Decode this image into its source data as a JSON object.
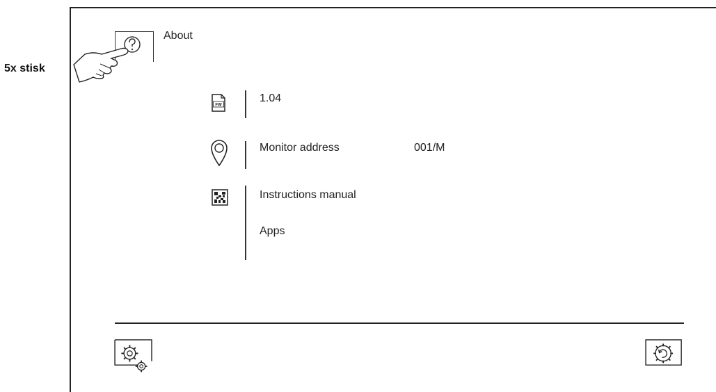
{
  "annotation": {
    "press_hint": "5x stisk"
  },
  "header": {
    "title": "About"
  },
  "info": {
    "firmware_version": "1.04",
    "monitor_address_label": "Monitor address",
    "monitor_address_value": "001/M",
    "instructions_manual_label": "Instructions manual",
    "apps_label": "Apps"
  },
  "icons": {
    "about": "question-mark-icon",
    "press": "pointing-hand-icon",
    "firmware": "fw-file-icon",
    "address": "location-pin-icon",
    "qr": "qr-code-icon",
    "settings_left": "settings-gears-icon",
    "settings_right": "settings-reset-icon"
  },
  "firmware_icon_text": "FW"
}
